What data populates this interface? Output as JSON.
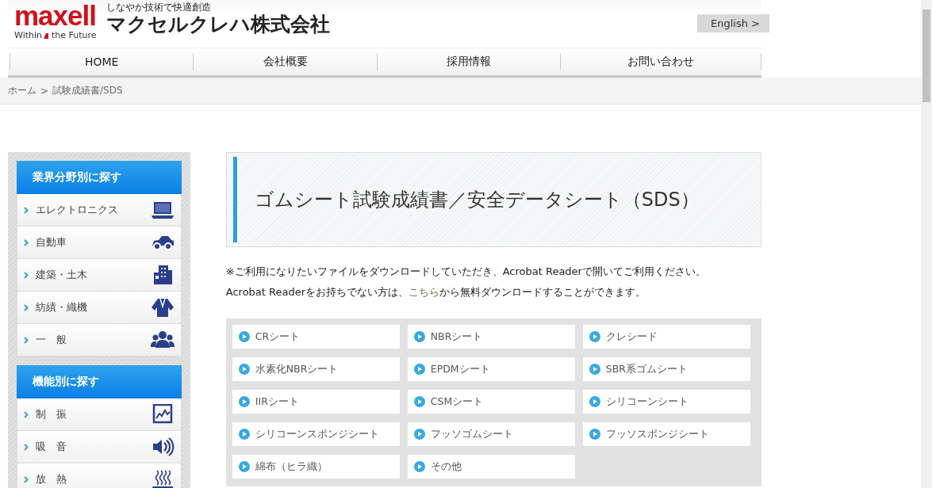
{
  "header": {
    "logo": {
      "brand": "maxell",
      "tagline_left": "Within",
      "tagline_right": "the Future"
    },
    "slogan": "しなやか技術で快適創造",
    "company": "マクセルクレハ株式会社",
    "language_button": "English >"
  },
  "nav": [
    {
      "label": "HOME"
    },
    {
      "label": "会社概要"
    },
    {
      "label": "採用情報"
    },
    {
      "label": "お問い合わせ"
    }
  ],
  "breadcrumb": {
    "home": "ホーム",
    "separator": ">",
    "current": "試験成績書/SDS"
  },
  "sidebar": [
    {
      "title": "業界分野別に探す",
      "items": [
        "エレクトロニクス",
        "自動車",
        "建築・土木",
        "紡績・織機",
        "一　般"
      ]
    },
    {
      "title": "機能別に探す",
      "items": [
        "制　振",
        "吸　音",
        "放　熱"
      ]
    }
  ],
  "main": {
    "title": "ゴムシート試験成績書／安全データシート（SDS）",
    "note_line_1": "※ご利用になりたいファイルをダウンロードしていただき、Acrobat Readerで開いてご利用ください。",
    "note_line_2_before": "Acrobat Readerをお持ちでない方は、",
    "note_link": "こちら",
    "note_line_2_after": "から無料ダウンロードすることができます。",
    "documents": [
      "CRシート",
      "NBRシート",
      "クレシード",
      "水素化NBRシート",
      "EPDMシート",
      "SBR系ゴムシート",
      "IIRシート",
      "CSMシート",
      "シリコーンシート",
      "シリコーンスポンジシート",
      "フッソゴムシート",
      "フッソスポンジシート",
      "綿布（ヒラ織）",
      "その他"
    ]
  }
}
